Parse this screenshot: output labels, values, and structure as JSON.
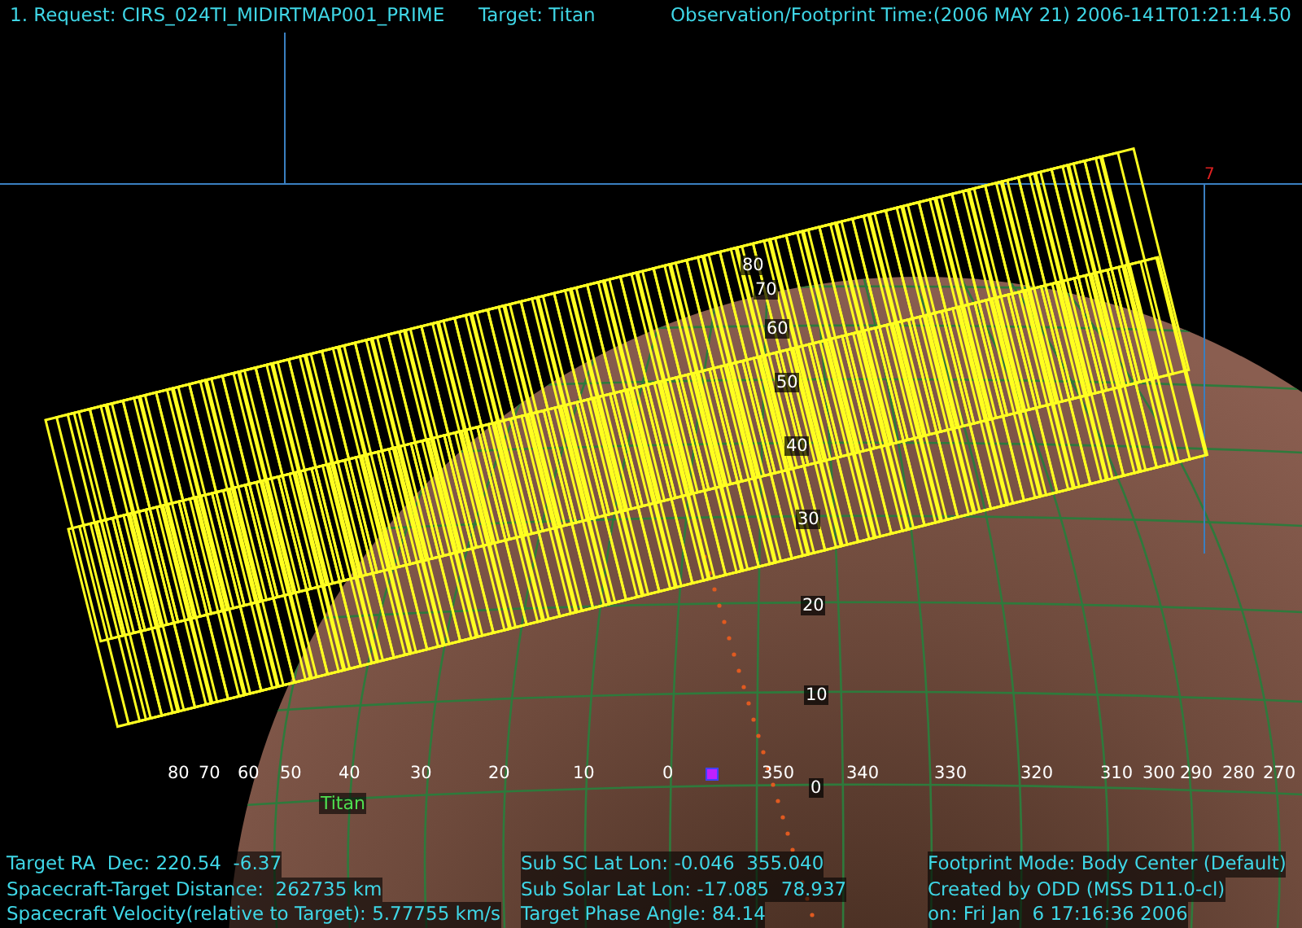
{
  "header": {
    "request": "1. Request:  CIRS_024TI_MIDIRTMAP001_PRIME",
    "target": "Target: Titan",
    "time": "Observation/Footprint Time:(2006 MAY 21) 2006-141T01:21:14.50"
  },
  "marker": "7",
  "target_label": "Titan",
  "longitude_labels": [
    "80",
    "70",
    "60",
    "50",
    "40",
    "30",
    "20",
    "10",
    "0",
    "350",
    "340",
    "330",
    "320",
    "310",
    "300",
    "290",
    "280",
    "270"
  ],
  "latitude_labels": [
    "80",
    "70",
    "60",
    "50",
    "40",
    "30",
    "20",
    "10",
    "0"
  ],
  "info_columns": [
    [
      "Target RA  Dec: 220.54  -6.37",
      "Spacecraft-Target Distance:  262735 km",
      "Spacecraft Velocity(relative to Target): 5.77755 km/s"
    ],
    [
      "Sub SC Lat Lon: -0.046  355.040",
      "Sub Solar Lat Lon: -17.085  78.937",
      "Target Phase Angle: 84.14"
    ],
    [
      "Footprint Mode: Body Center (Default)",
      "Created by ODD (MSS D11.0-cl)",
      "on: Fri Jan  6 17:16:36 2006"
    ]
  ]
}
